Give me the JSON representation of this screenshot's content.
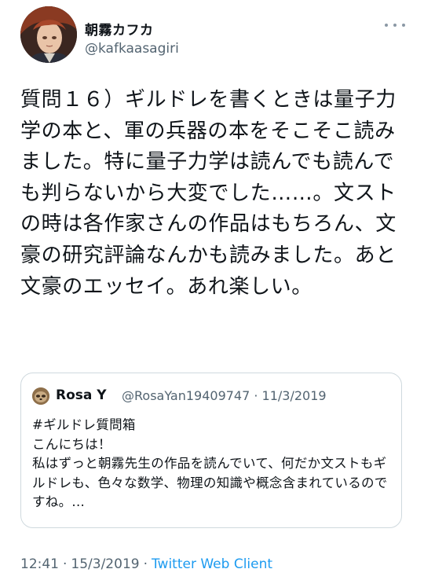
{
  "author": {
    "display_name": "朝霧カフカ",
    "handle": "@kafkaasagiri"
  },
  "tweet": {
    "text": "質問１６）ギルドレを書くときは量子力学の本と、軍の兵器の本をそこそこ読みました。特に量子力学は読んでも読んでも判らないから大変でした……。文ストの時は各作家さんの作品はもちろん、文豪の研究評論なんかも読みました。あと文豪のエッセイ。あれ楽しい。"
  },
  "quoted": {
    "name": "Rosa Y",
    "meta": "@RosaYan19409747 · 11/3/2019",
    "text": "#ギルドレ質問箱\nこんにちは！\n私はずっと朝霧先生の作品を読んでいて、何だか文ストもギルドレも、色々な数学、物理の知識や概念含まれているのですね。..."
  },
  "footer": {
    "time": "12:41",
    "date": "15/3/2019",
    "separator": "·",
    "client": "Twitter Web Client"
  },
  "icons": {
    "more": "more-dots-icon",
    "avatar": "anime-character-avatar",
    "quote_avatar": "sloth-avatar"
  }
}
